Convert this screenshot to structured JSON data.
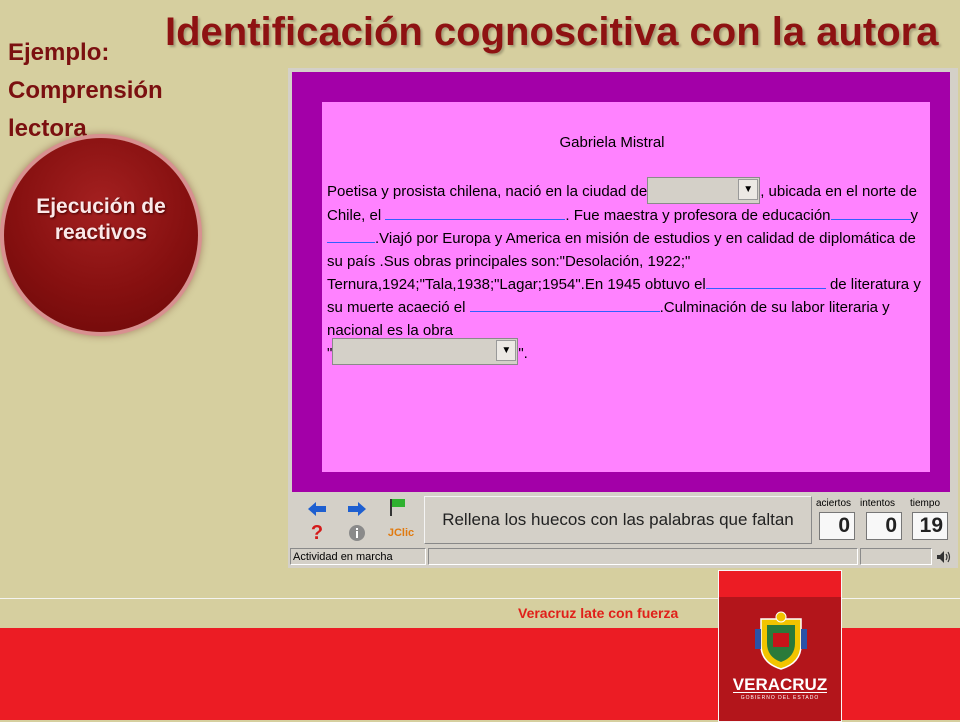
{
  "slide": {
    "title": "Identificación cognoscitiva con la autora",
    "left_text": [
      "Ejemplo:",
      "Comprensión",
      "lectora"
    ],
    "circle_label": "Ejecución de reactivos",
    "tagline": "Veracruz late con fuerza",
    "logo_text": "VERACRUZ",
    "logo_subtext": "GOBIERNO DEL ESTADO"
  },
  "activity": {
    "heading": "Gabriela Mistral",
    "passage": {
      "s1": "Poetisa y prosista chilena, nació en la ciudad de",
      "s2": ", ubicada en el norte de Chile, el",
      "s3": ". Fue maestra y profesora de educación",
      "s4": "y",
      "s5": ".Viajó por Europa y America en misión de estudios y en calidad de diplomática de su país .Sus obras principales son:\"Desolación, 1922;\" Ternura,1924;\"Tala,1938;\"Lagar;1954\".En 1945 obtuvo el",
      "s6": "de literatura y su muerte acaeció el",
      "s7": ".Culminación de su labor literaria y nacional es la obra",
      "s8_open": "\"",
      "s8_close": "\"."
    },
    "combo_selected": [
      "",
      ""
    ]
  },
  "toolbar": {
    "message": "Rellena los huecos con las palabras que faltan",
    "jclic_label": "JClic",
    "counters": {
      "aciertos_label": "aciertos",
      "intentos_label": "intentos",
      "tiempo_label": "tiempo",
      "aciertos": "0",
      "intentos": "0",
      "tiempo": "19"
    },
    "icons": [
      "back-arrow-icon",
      "forward-arrow-icon",
      "flag-icon",
      "help-icon",
      "info-icon",
      "jclic-logo-icon",
      "sound-icon"
    ]
  },
  "status": {
    "text": "Actividad en marcha"
  },
  "colors": {
    "background": "#d6cf9f",
    "title": "#8e1212",
    "frame": "#a300a8",
    "panel": "#ff82ff",
    "red_band": "#ec1c24"
  }
}
